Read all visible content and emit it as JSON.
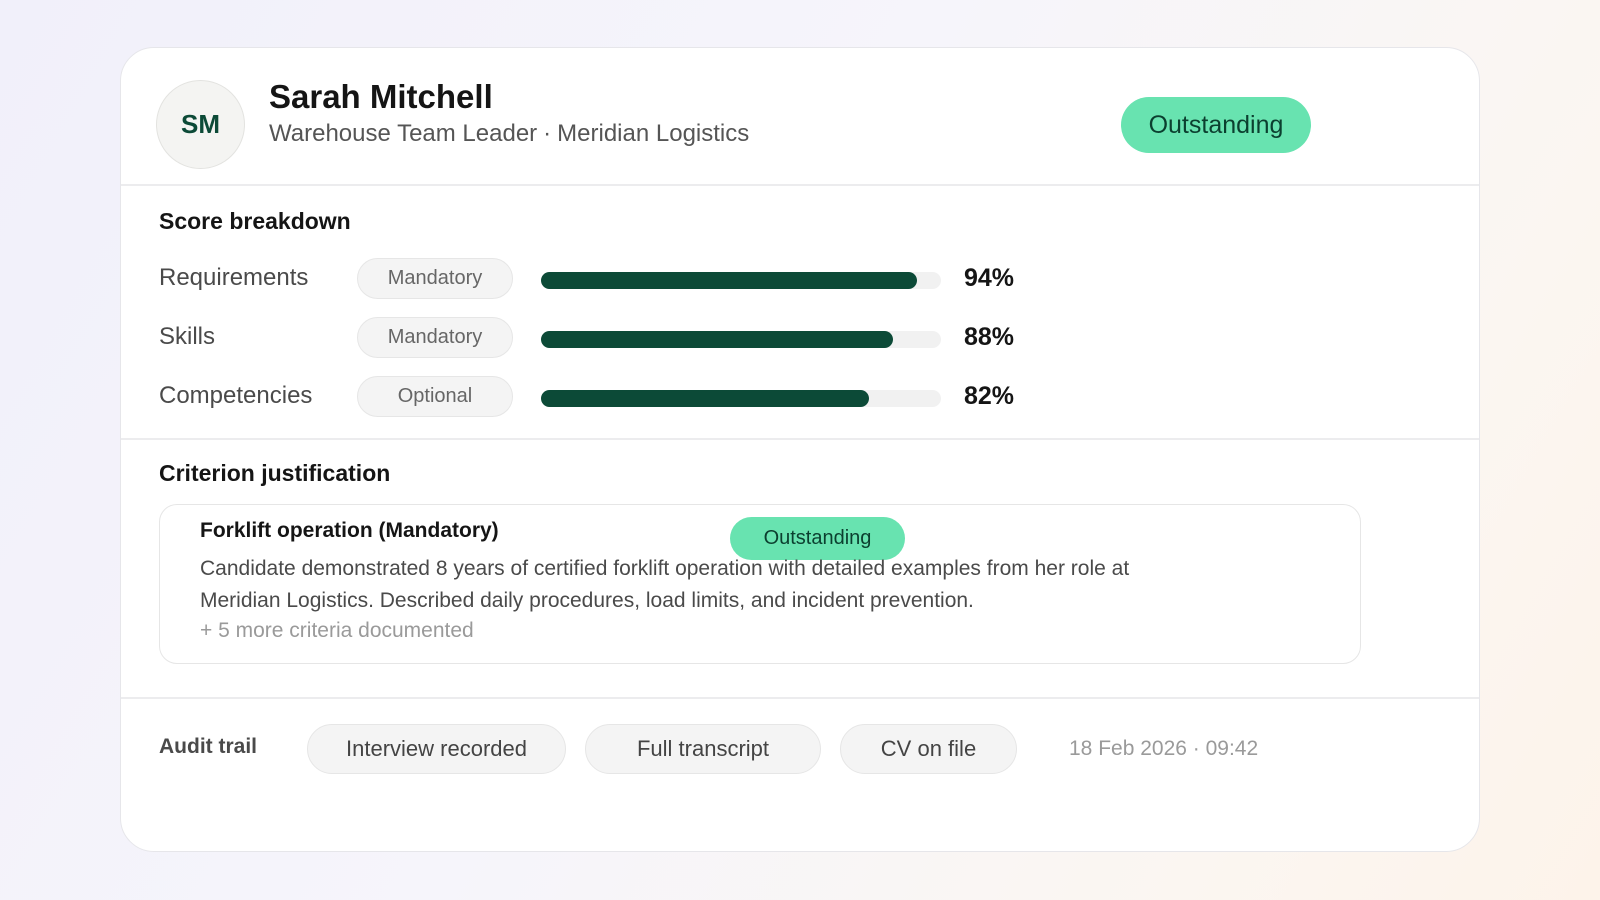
{
  "candidate": {
    "initials": "SM",
    "name": "Sarah Mitchell",
    "role": "Warehouse Team Leader",
    "separator": "·",
    "company": "Meridian Logistics",
    "rating": "Outstanding"
  },
  "scores": {
    "title": "Score breakdown",
    "rows": [
      {
        "label": "Requirements",
        "tag": "Mandatory",
        "value": 94,
        "display": "94%"
      },
      {
        "label": "Skills",
        "tag": "Mandatory",
        "value": 88,
        "display": "88%"
      },
      {
        "label": "Competencies",
        "tag": "Optional",
        "value": 82,
        "display": "82%"
      }
    ]
  },
  "justification": {
    "title": "Criterion justification",
    "criterion": "Forklift operation (Mandatory)",
    "rating": "Outstanding",
    "text": "Candidate demonstrated 8 years of certified forklift operation with detailed examples from her role at Meridian Logistics. Described daily procedures, load limits, and incident prevention.",
    "more": "+ 5 more criteria documented"
  },
  "audit": {
    "label": "Audit trail",
    "items": [
      "Interview recorded",
      "Full transcript",
      "CV on file"
    ],
    "timestamp": "18 Feb 2026 · 09:42"
  },
  "colors": {
    "accent": "#0c4a37",
    "badge": "#68e3b0"
  }
}
